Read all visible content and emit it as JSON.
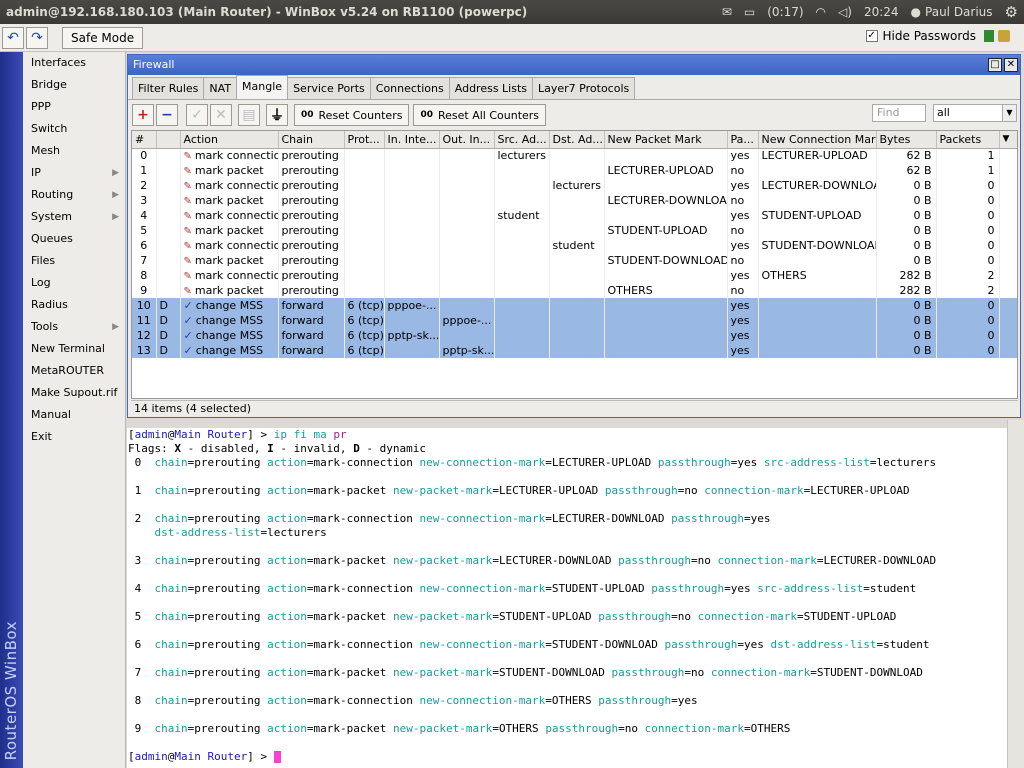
{
  "window_title": "admin@192.168.180.103 (Main Router) - WinBox v5.24 on RB1100 (powerpc)",
  "tray": {
    "battery": "(0:17)",
    "clock": "20:24",
    "user": "Paul Darius"
  },
  "toolbar": {
    "safe_mode": "Safe Mode",
    "hide_passwords": "Hide Passwords"
  },
  "brand": "RouterOS WinBox",
  "menu": [
    {
      "label": "Interfaces",
      "sub": false
    },
    {
      "label": "Bridge",
      "sub": false
    },
    {
      "label": "PPP",
      "sub": false
    },
    {
      "label": "Switch",
      "sub": false
    },
    {
      "label": "Mesh",
      "sub": false
    },
    {
      "label": "IP",
      "sub": true
    },
    {
      "label": "Routing",
      "sub": true
    },
    {
      "label": "System",
      "sub": true
    },
    {
      "label": "Queues",
      "sub": false
    },
    {
      "label": "Files",
      "sub": false
    },
    {
      "label": "Log",
      "sub": false
    },
    {
      "label": "Radius",
      "sub": false
    },
    {
      "label": "Tools",
      "sub": true
    },
    {
      "label": "New Terminal",
      "sub": false
    },
    {
      "label": "MetaROUTER",
      "sub": false
    },
    {
      "label": "Make Supout.rif",
      "sub": false
    },
    {
      "label": "Manual",
      "sub": false
    },
    {
      "label": "Exit",
      "sub": false
    }
  ],
  "firewall": {
    "title": "Firewall",
    "tabs": [
      "Filter Rules",
      "NAT",
      "Mangle",
      "Service Ports",
      "Connections",
      "Address Lists",
      "Layer7 Protocols"
    ],
    "active_tab": 2,
    "reset_counters": "Reset Counters",
    "reset_all_counters": "Reset All Counters",
    "find_placeholder": "Find",
    "filter_value": "all",
    "columns": [
      "#",
      "",
      "Action",
      "Chain",
      "Prot...",
      "In. Inte...",
      "Out. In...",
      "Src. Ad...",
      "Dst. Ad...",
      "New Packet Mark",
      "Pa...",
      "New Connection Mark",
      "Bytes",
      "Packets"
    ],
    "rows": [
      [
        "0",
        "",
        "mark connection",
        "prerouting",
        "",
        "",
        "",
        "lecturers",
        "",
        "",
        "yes",
        "LECTURER-UPLOAD",
        "62 B",
        "1"
      ],
      [
        "1",
        "",
        "mark packet",
        "prerouting",
        "",
        "",
        "",
        "",
        "",
        "LECTURER-UPLOAD",
        "no",
        "",
        "62 B",
        "1"
      ],
      [
        "2",
        "",
        "mark connection",
        "prerouting",
        "",
        "",
        "",
        "",
        "lecturers",
        "",
        "yes",
        "LECTURER-DOWNLOAD",
        "0 B",
        "0"
      ],
      [
        "3",
        "",
        "mark packet",
        "prerouting",
        "",
        "",
        "",
        "",
        "",
        "LECTURER-DOWNLOAD",
        "no",
        "",
        "0 B",
        "0"
      ],
      [
        "4",
        "",
        "mark connection",
        "prerouting",
        "",
        "",
        "",
        "student",
        "",
        "",
        "yes",
        "STUDENT-UPLOAD",
        "0 B",
        "0"
      ],
      [
        "5",
        "",
        "mark packet",
        "prerouting",
        "",
        "",
        "",
        "",
        "",
        "STUDENT-UPLOAD",
        "no",
        "",
        "0 B",
        "0"
      ],
      [
        "6",
        "",
        "mark connection",
        "prerouting",
        "",
        "",
        "",
        "",
        "student",
        "",
        "yes",
        "STUDENT-DOWNLOAD",
        "0 B",
        "0"
      ],
      [
        "7",
        "",
        "mark packet",
        "prerouting",
        "",
        "",
        "",
        "",
        "",
        "STUDENT-DOWNLOAD",
        "no",
        "",
        "0 B",
        "0"
      ],
      [
        "8",
        "",
        "mark connection",
        "prerouting",
        "",
        "",
        "",
        "",
        "",
        "",
        "yes",
        "OTHERS",
        "282 B",
        "2"
      ],
      [
        "9",
        "",
        "mark packet",
        "prerouting",
        "",
        "",
        "",
        "",
        "",
        "OTHERS",
        "no",
        "",
        "282 B",
        "2"
      ],
      [
        "10",
        "D",
        "change MSS",
        "forward",
        "6 (tcp)",
        "pppoe-...",
        "",
        "",
        "",
        "",
        "yes",
        "",
        "0 B",
        "0"
      ],
      [
        "11",
        "D",
        "change MSS",
        "forward",
        "6 (tcp)",
        "",
        "pppoe-...",
        "",
        "",
        "",
        "yes",
        "",
        "0 B",
        "0"
      ],
      [
        "12",
        "D",
        "change MSS",
        "forward",
        "6 (tcp)",
        "pptp-sk...",
        "",
        "",
        "",
        "",
        "yes",
        "",
        "0 B",
        "0"
      ],
      [
        "13",
        "D",
        "change MSS",
        "forward",
        "6 (tcp)",
        "",
        "pptp-sk...",
        "",
        "",
        "",
        "yes",
        "",
        "0 B",
        "0"
      ]
    ],
    "selected_rows": [
      10,
      11,
      12,
      13
    ],
    "status": "14 items (4 selected)"
  },
  "terminal": {
    "prompt_user": "admin",
    "prompt_host": "Main Router",
    "command_parts": [
      "ip",
      "fi",
      "ma",
      "pr"
    ],
    "flags_line": "Flags: X - disabled, I - invalid, D - dynamic",
    "entries": [
      {
        "n": " 0",
        "lines": [
          [
            [
              "chain",
              "prerouting"
            ],
            [
              "action",
              "mark-connection"
            ],
            [
              "new-connection-mark",
              "LECTURER-UPLOAD"
            ],
            [
              "passthrough",
              "yes"
            ],
            [
              "src-address-list",
              "lecturers"
            ]
          ]
        ]
      },
      {
        "n": " 1",
        "lines": [
          [
            [
              "chain",
              "prerouting"
            ],
            [
              "action",
              "mark-packet"
            ],
            [
              "new-packet-mark",
              "LECTURER-UPLOAD"
            ],
            [
              "passthrough",
              "no"
            ],
            [
              "connection-mark",
              "LECTURER-UPLOAD"
            ]
          ]
        ]
      },
      {
        "n": " 2",
        "lines": [
          [
            [
              "chain",
              "prerouting"
            ],
            [
              "action",
              "mark-connection"
            ],
            [
              "new-connection-mark",
              "LECTURER-DOWNLOAD"
            ],
            [
              "passthrough",
              "yes"
            ]
          ],
          [
            [
              "dst-address-list",
              "lecturers"
            ]
          ]
        ]
      },
      {
        "n": " 3",
        "lines": [
          [
            [
              "chain",
              "prerouting"
            ],
            [
              "action",
              "mark-packet"
            ],
            [
              "new-packet-mark",
              "LECTURER-DOWNLOAD"
            ],
            [
              "passthrough",
              "no"
            ],
            [
              "connection-mark",
              "LECTURER-DOWNLOAD"
            ]
          ]
        ]
      },
      {
        "n": " 4",
        "lines": [
          [
            [
              "chain",
              "prerouting"
            ],
            [
              "action",
              "mark-connection"
            ],
            [
              "new-connection-mark",
              "STUDENT-UPLOAD"
            ],
            [
              "passthrough",
              "yes"
            ],
            [
              "src-address-list",
              "student"
            ]
          ]
        ]
      },
      {
        "n": " 5",
        "lines": [
          [
            [
              "chain",
              "prerouting"
            ],
            [
              "action",
              "mark-packet"
            ],
            [
              "new-packet-mark",
              "STUDENT-UPLOAD"
            ],
            [
              "passthrough",
              "no"
            ],
            [
              "connection-mark",
              "STUDENT-UPLOAD"
            ]
          ]
        ]
      },
      {
        "n": " 6",
        "lines": [
          [
            [
              "chain",
              "prerouting"
            ],
            [
              "action",
              "mark-connection"
            ],
            [
              "new-connection-mark",
              "STUDENT-DOWNLOAD"
            ],
            [
              "passthrough",
              "yes"
            ],
            [
              "dst-address-list",
              "student"
            ]
          ]
        ]
      },
      {
        "n": " 7",
        "lines": [
          [
            [
              "chain",
              "prerouting"
            ],
            [
              "action",
              "mark-packet"
            ],
            [
              "new-packet-mark",
              "STUDENT-DOWNLOAD"
            ],
            [
              "passthrough",
              "no"
            ],
            [
              "connection-mark",
              "STUDENT-DOWNLOAD"
            ]
          ]
        ]
      },
      {
        "n": " 8",
        "lines": [
          [
            [
              "chain",
              "prerouting"
            ],
            [
              "action",
              "mark-connection"
            ],
            [
              "new-connection-mark",
              "OTHERS"
            ],
            [
              "passthrough",
              "yes"
            ]
          ]
        ]
      },
      {
        "n": " 9",
        "lines": [
          [
            [
              "chain",
              "prerouting"
            ],
            [
              "action",
              "mark-packet"
            ],
            [
              "new-packet-mark",
              "OTHERS"
            ],
            [
              "passthrough",
              "no"
            ],
            [
              "connection-mark",
              "OTHERS"
            ]
          ]
        ]
      }
    ]
  }
}
